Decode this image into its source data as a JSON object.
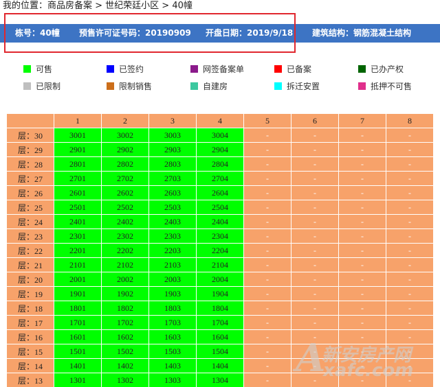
{
  "breadcrumb": "我的位置：商品房备案 > 世纪荣廷小区 > 40幢",
  "info": {
    "building": "栋号：40幢",
    "permit": "预售许可证号码：20190909",
    "open_date": "开盘日期：2019/9/18",
    "structure": "建筑结构：钢筋混凝土结构"
  },
  "legend": [
    {
      "label": "可售",
      "color": "#00ff00"
    },
    {
      "label": "已签约",
      "color": "#0000ff"
    },
    {
      "label": "网签备案单",
      "color": "#8b1a8b"
    },
    {
      "label": "已备案",
      "color": "#ff0000"
    },
    {
      "label": "已办产权",
      "color": "#006400"
    },
    {
      "label": "已限制",
      "color": "#bfbfbf"
    },
    {
      "label": "限制销售",
      "color": "#cc6e1a"
    },
    {
      "label": "自建房",
      "color": "#3cc8a0"
    },
    {
      "label": "拆迁安置",
      "color": "#00ffff"
    },
    {
      "label": "抵押不可售",
      "color": "#e0308c"
    }
  ],
  "colors": {
    "available": "#00ff00",
    "header": "#f7a26a",
    "empty": "#f7a26a",
    "info_bar": "#3d74c4",
    "highlight_box": "#e0262d"
  },
  "grid": {
    "columns": [
      "1",
      "2",
      "3",
      "4",
      "5",
      "6",
      "7",
      "8"
    ],
    "rows": [
      {
        "floor": "层：30",
        "units": [
          "3001",
          "3002",
          "3003",
          "3004",
          "-",
          "-",
          "-",
          "-"
        ]
      },
      {
        "floor": "层：29",
        "units": [
          "2901",
          "2902",
          "2903",
          "2904",
          "-",
          "-",
          "-",
          "-"
        ]
      },
      {
        "floor": "层：28",
        "units": [
          "2801",
          "2802",
          "2803",
          "2804",
          "-",
          "-",
          "-",
          "-"
        ]
      },
      {
        "floor": "层：27",
        "units": [
          "2701",
          "2702",
          "2703",
          "2704",
          "-",
          "-",
          "-",
          "-"
        ]
      },
      {
        "floor": "层：26",
        "units": [
          "2601",
          "2602",
          "2603",
          "2604",
          "-",
          "-",
          "-",
          "-"
        ]
      },
      {
        "floor": "层：25",
        "units": [
          "2501",
          "2502",
          "2503",
          "2504",
          "-",
          "-",
          "-",
          "-"
        ]
      },
      {
        "floor": "层：24",
        "units": [
          "2401",
          "2402",
          "2403",
          "2404",
          "-",
          "-",
          "-",
          "-"
        ]
      },
      {
        "floor": "层：23",
        "units": [
          "2301",
          "2302",
          "2303",
          "2304",
          "-",
          "-",
          "-",
          "-"
        ]
      },
      {
        "floor": "层：22",
        "units": [
          "2201",
          "2202",
          "2203",
          "2204",
          "-",
          "-",
          "-",
          "-"
        ]
      },
      {
        "floor": "层：21",
        "units": [
          "2101",
          "2102",
          "2103",
          "2104",
          "-",
          "-",
          "-",
          "-"
        ]
      },
      {
        "floor": "层：20",
        "units": [
          "2001",
          "2002",
          "2003",
          "2004",
          "-",
          "-",
          "-",
          "-"
        ]
      },
      {
        "floor": "层：19",
        "units": [
          "1901",
          "1902",
          "1903",
          "1904",
          "-",
          "-",
          "-",
          "-"
        ]
      },
      {
        "floor": "层：18",
        "units": [
          "1801",
          "1802",
          "1803",
          "1804",
          "-",
          "-",
          "-",
          "-"
        ]
      },
      {
        "floor": "层：17",
        "units": [
          "1701",
          "1702",
          "1703",
          "1704",
          "-",
          "-",
          "-",
          "-"
        ]
      },
      {
        "floor": "层：16",
        "units": [
          "1601",
          "1602",
          "1603",
          "1604",
          "-",
          "-",
          "-",
          "-"
        ]
      },
      {
        "floor": "层：15",
        "units": [
          "1501",
          "1502",
          "1503",
          "1504",
          "-",
          "-",
          "-",
          "-"
        ]
      },
      {
        "floor": "层：14",
        "units": [
          "1401",
          "1402",
          "1403",
          "1404",
          "-",
          "-",
          "-",
          "-"
        ]
      },
      {
        "floor": "层：13",
        "units": [
          "1301",
          "1302",
          "1303",
          "1304",
          "-",
          "-",
          "-",
          "-"
        ]
      }
    ]
  },
  "watermark": {
    "symbol": "A",
    "cn": "新安房产网",
    "en": "xafc.com"
  }
}
